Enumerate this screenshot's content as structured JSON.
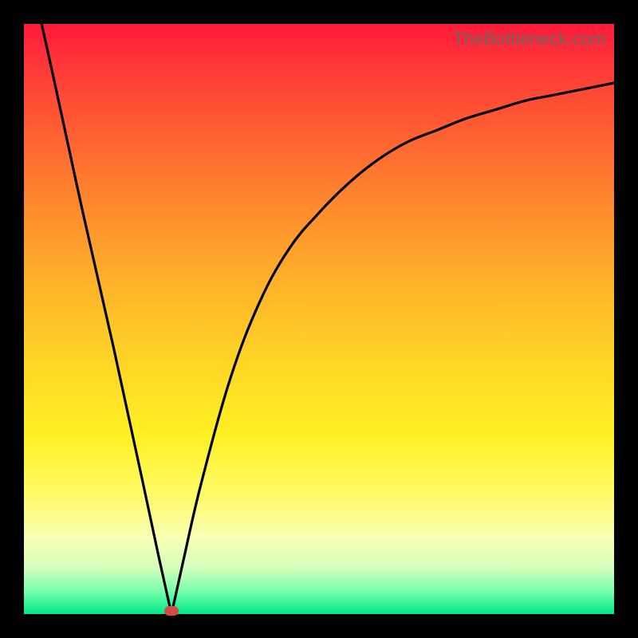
{
  "watermark": "TheBottleneck.com",
  "gradient": {
    "top": "#ff1a3a",
    "bottom": "#00e789"
  },
  "marker": {
    "x_pct": 25.0,
    "y_pct": 99.5
  },
  "chart_data": {
    "type": "line",
    "title": "",
    "xlabel": "",
    "ylabel": "",
    "xlim": [
      0,
      100
    ],
    "ylim": [
      0,
      100
    ],
    "grid": false,
    "series": [
      {
        "name": "left-branch",
        "x": [
          3,
          5,
          10,
          15,
          20,
          23,
          25
        ],
        "values": [
          100,
          91,
          68,
          46,
          23,
          9,
          0
        ]
      },
      {
        "name": "right-branch",
        "x": [
          25,
          27,
          30,
          35,
          40,
          45,
          50,
          55,
          60,
          65,
          70,
          75,
          80,
          85,
          90,
          95,
          100
        ],
        "values": [
          0,
          9,
          22,
          40,
          53,
          62,
          68,
          73,
          77,
          80,
          82,
          84,
          85.5,
          87,
          88,
          89,
          90
        ]
      }
    ],
    "annotations": [
      {
        "type": "marker",
        "x": 25,
        "y": 0.5,
        "color": "#d34b45"
      }
    ]
  }
}
